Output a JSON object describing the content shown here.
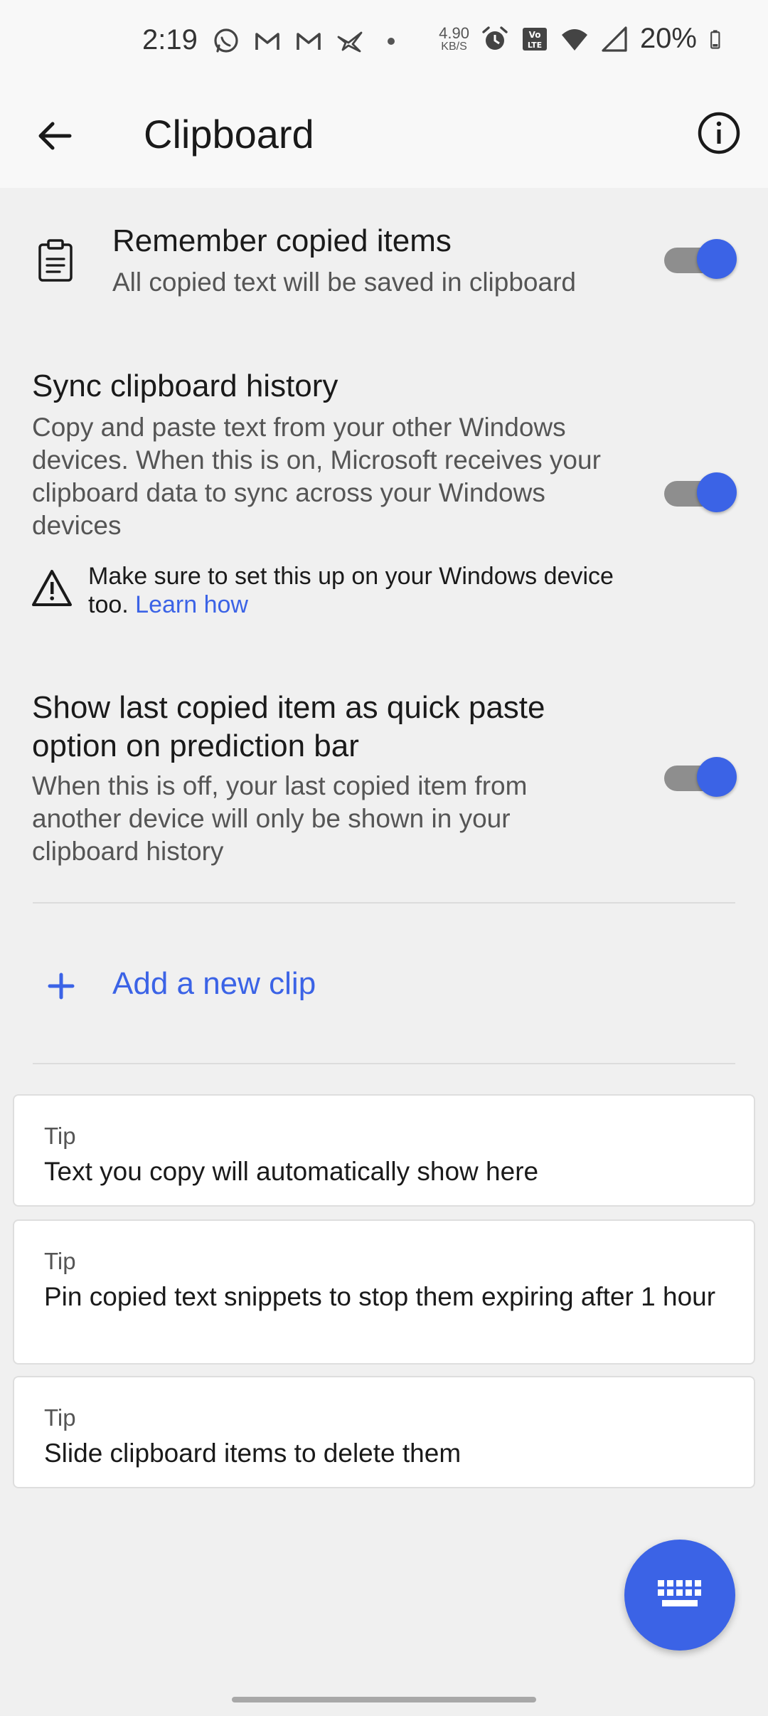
{
  "status_bar": {
    "time": "2:19",
    "net_speed_value": "4.90",
    "net_speed_unit": "KB/S",
    "battery_percent": "20%",
    "icons": [
      "whatsapp-icon",
      "gmail-icon",
      "gmail-icon",
      "bird-app-icon",
      "dot-icon",
      "alarm-icon",
      "volte-icon",
      "wifi-icon",
      "signal-icon",
      "battery-icon"
    ]
  },
  "app_bar": {
    "title": "Clipboard",
    "back_icon": "arrow-left-icon",
    "info_icon": "info-circle-icon"
  },
  "settings": {
    "remember": {
      "title": "Remember copied items",
      "description": "All copied text will be saved in clipboard",
      "enabled": true
    },
    "sync": {
      "title": "Sync clipboard history",
      "description": "Copy and paste text from your other Windows devices. When this is on, Microsoft receives your clipboard data to sync across your Windows devices",
      "enabled": true,
      "warning_text": "Make sure to set this up on your Windows device too.",
      "learn_link": "Learn how"
    },
    "quick_paste": {
      "title": "Show last copied item as quick paste option on prediction bar",
      "description": "When this is off, your last copied item from another device will only be shown in your clipboard history",
      "enabled": true
    }
  },
  "add_clip": {
    "label": "Add a new clip"
  },
  "tips": [
    {
      "label": "Tip",
      "text": "Text you copy will automatically show here"
    },
    {
      "label": "Tip",
      "text": "Pin copied text snippets to stop them expiring after 1 hour"
    },
    {
      "label": "Tip",
      "text": "Slide clipboard items to delete them"
    }
  ],
  "colors": {
    "accent": "#3b63e6",
    "background": "#f0f0f0",
    "card": "#ffffff"
  }
}
